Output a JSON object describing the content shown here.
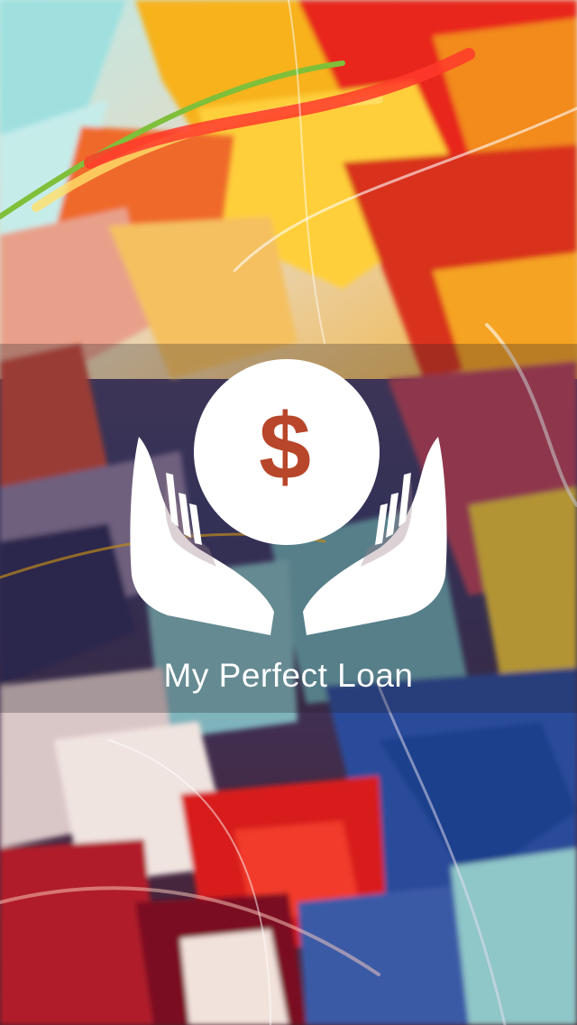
{
  "splash": {
    "app_name": "My Perfect Loan",
    "logo": {
      "icon": "hands-holding-coin-icon",
      "coin_symbol": "$",
      "color": "#ffffff"
    },
    "background": {
      "style": "abstract colorful paint strokes",
      "colors": [
        "#e8251c",
        "#f7b21a",
        "#ffd84a",
        "#9fd6d8",
        "#1c3f8c",
        "#7a1020",
        "#f2e2dc"
      ]
    }
  }
}
